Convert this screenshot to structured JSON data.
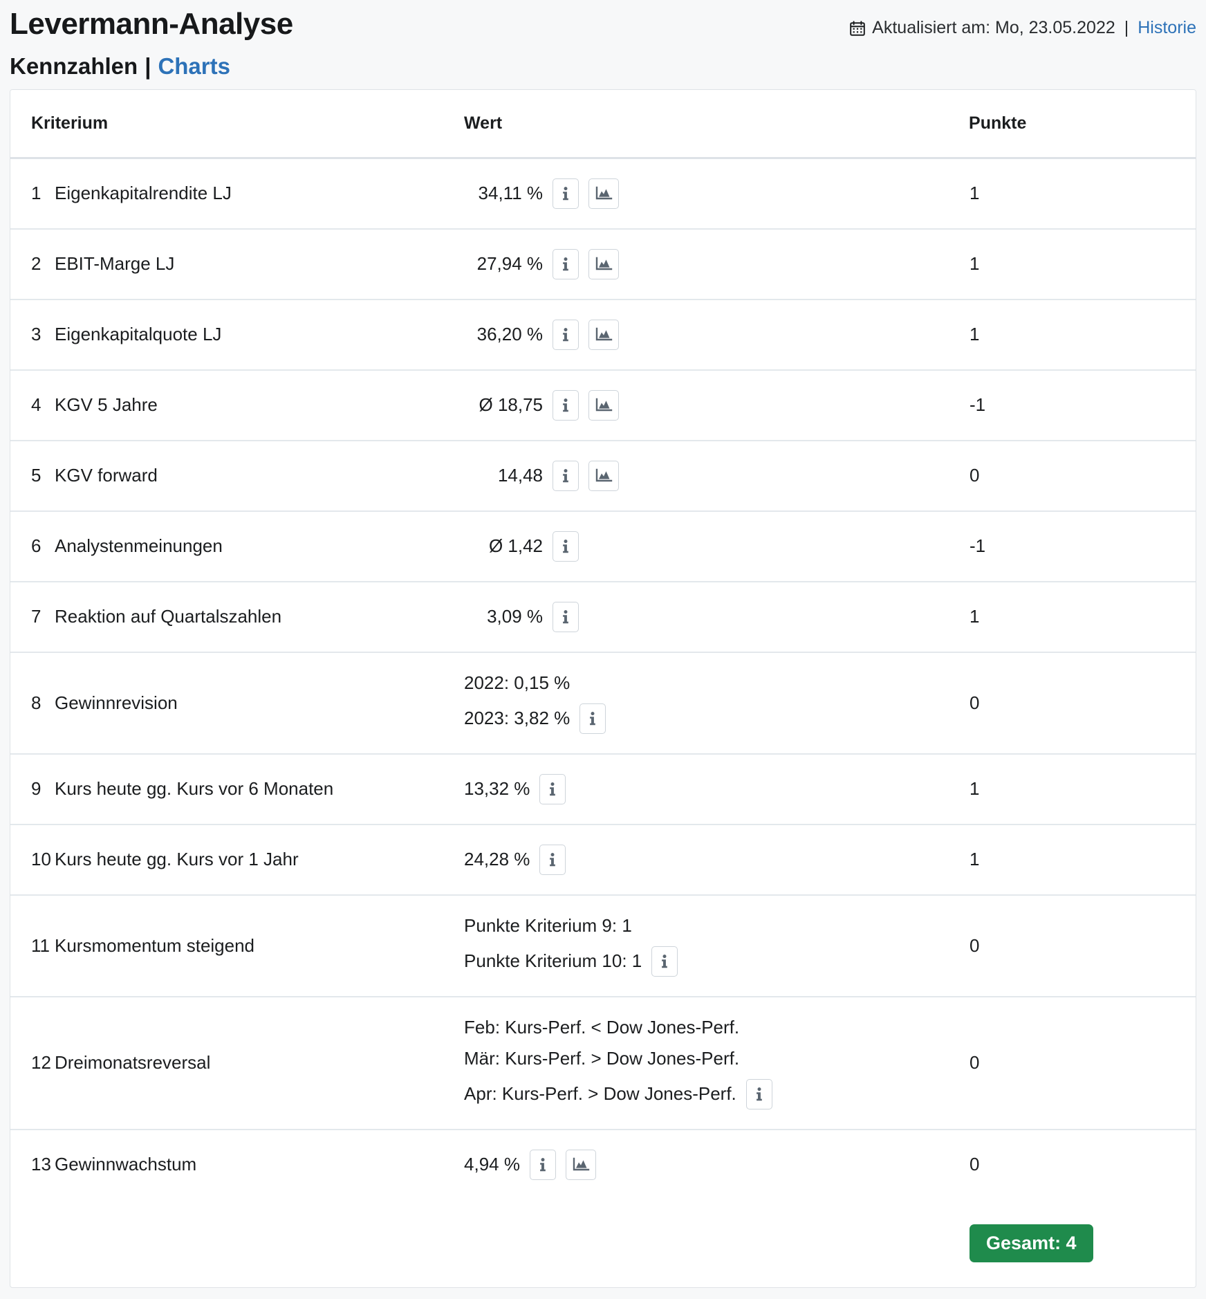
{
  "header": {
    "title": "Levermann-Analyse",
    "updated_icon": "calendar-icon",
    "updated_label": "Aktualisiert am: Mo, 23.05.2022",
    "separator": "|",
    "history_link": "Historie"
  },
  "subnav": {
    "tab_kennzahlen": "Kennzahlen",
    "pipe": "|",
    "tab_charts": "Charts"
  },
  "table": {
    "columns": {
      "kriterium": "Kriterium",
      "wert": "Wert",
      "punkte": "Punkte"
    },
    "rows": [
      {
        "num": "1",
        "name": "Eigenkapitalrendite LJ",
        "lines": [
          "34,11 %"
        ],
        "icons_on_line": 0,
        "icons": [
          "info-icon",
          "chart-icon"
        ],
        "align": "right",
        "points": "1"
      },
      {
        "num": "2",
        "name": "EBIT-Marge LJ",
        "lines": [
          "27,94 %"
        ],
        "icons_on_line": 0,
        "icons": [
          "info-icon",
          "chart-icon"
        ],
        "align": "right",
        "points": "1"
      },
      {
        "num": "3",
        "name": "Eigenkapitalquote LJ",
        "lines": [
          "36,20 %"
        ],
        "icons_on_line": 0,
        "icons": [
          "info-icon",
          "chart-icon"
        ],
        "align": "right",
        "points": "1"
      },
      {
        "num": "4",
        "name": "KGV 5 Jahre",
        "lines": [
          "Ø 18,75"
        ],
        "icons_on_line": 0,
        "icons": [
          "info-icon",
          "chart-icon"
        ],
        "align": "right",
        "points": "-1"
      },
      {
        "num": "5",
        "name": "KGV forward",
        "lines": [
          "14,48"
        ],
        "icons_on_line": 0,
        "icons": [
          "info-icon",
          "chart-icon"
        ],
        "align": "right",
        "points": "0"
      },
      {
        "num": "6",
        "name": "Analystenmeinungen",
        "lines": [
          "Ø 1,42"
        ],
        "icons_on_line": 0,
        "icons": [
          "info-icon"
        ],
        "align": "right",
        "points": "-1"
      },
      {
        "num": "7",
        "name": "Reaktion auf Quartalszahlen",
        "lines": [
          "3,09 %"
        ],
        "icons_on_line": 0,
        "icons": [
          "info-icon"
        ],
        "align": "right",
        "points": "1"
      },
      {
        "num": "8",
        "name": "Gewinnrevision",
        "lines": [
          "2022: 0,15 %",
          "2023: 3,82 %"
        ],
        "icons_on_line": 1,
        "icons": [
          "info-icon"
        ],
        "align": "left",
        "points": "0"
      },
      {
        "num": "9",
        "name": "Kurs heute gg. Kurs vor 6 Monaten",
        "lines": [
          "13,32 %"
        ],
        "icons_on_line": 0,
        "icons": [
          "info-icon"
        ],
        "align": "left",
        "points": "1"
      },
      {
        "num": "10",
        "name": "Kurs heute gg. Kurs vor 1 Jahr",
        "lines": [
          "24,28 %"
        ],
        "icons_on_line": 0,
        "icons": [
          "info-icon"
        ],
        "align": "left",
        "points": "1"
      },
      {
        "num": "11",
        "name": "Kursmomentum steigend",
        "lines": [
          "Punkte Kriterium 9: 1",
          "Punkte Kriterium 10: 1"
        ],
        "icons_on_line": 1,
        "icons": [
          "info-icon"
        ],
        "align": "left",
        "points": "0"
      },
      {
        "num": "12",
        "name": "Dreimonatsreversal",
        "lines": [
          "Feb: Kurs-Perf. < Dow Jones-Perf.",
          "Mär: Kurs-Perf. > Dow Jones-Perf.",
          "Apr: Kurs-Perf. > Dow Jones-Perf."
        ],
        "icons_on_line": 2,
        "icons": [
          "info-icon"
        ],
        "align": "left",
        "points": "0"
      },
      {
        "num": "13",
        "name": "Gewinnwachstum",
        "lines": [
          "4,94 %"
        ],
        "icons_on_line": 0,
        "icons": [
          "info-icon",
          "chart-icon"
        ],
        "align": "left",
        "points": "0"
      }
    ],
    "total_badge": "Gesamt: 4"
  },
  "colors": {
    "link_blue": "#2d72b8",
    "badge_green": "#1f8b4c",
    "border_gray": "#dfe3e7",
    "page_bg": "#f7f8f9"
  }
}
